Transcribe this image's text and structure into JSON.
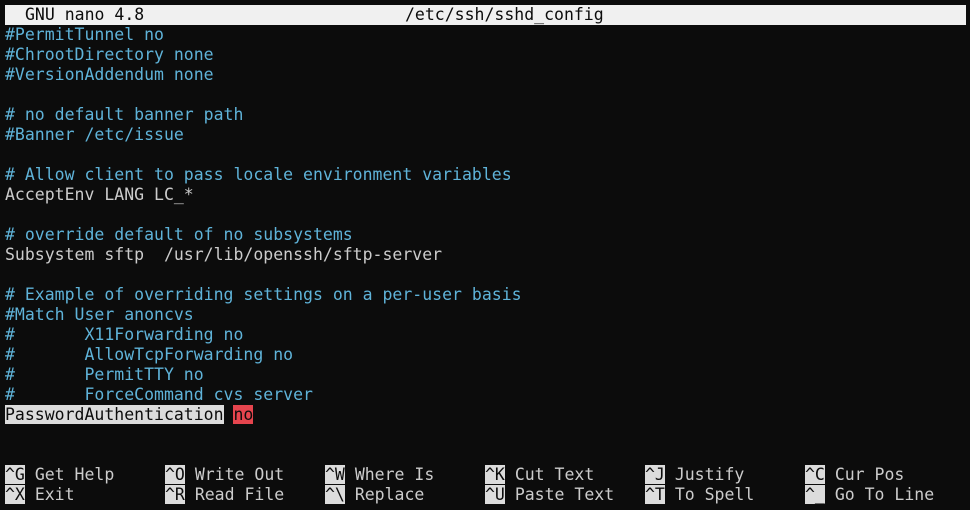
{
  "titlebar": {
    "app": "GNU nano 4.8",
    "file": "/etc/ssh/sshd_config"
  },
  "lines": [
    {
      "text": "#PermitTunnel no",
      "kind": "comment"
    },
    {
      "text": "#ChrootDirectory none",
      "kind": "comment"
    },
    {
      "text": "#VersionAddendum none",
      "kind": "comment"
    },
    {
      "text": "",
      "kind": "plain"
    },
    {
      "text": "# no default banner path",
      "kind": "comment"
    },
    {
      "text": "#Banner /etc/issue",
      "kind": "comment"
    },
    {
      "text": "",
      "kind": "plain"
    },
    {
      "text": "# Allow client to pass locale environment variables",
      "kind": "comment"
    },
    {
      "text": "AcceptEnv LANG LC_*",
      "kind": "plain"
    },
    {
      "text": "",
      "kind": "plain"
    },
    {
      "text": "# override default of no subsystems",
      "kind": "comment"
    },
    {
      "text": "Subsystem sftp  /usr/lib/openssh/sftp-server",
      "kind": "plain"
    },
    {
      "text": "",
      "kind": "plain"
    },
    {
      "text": "# Example of overriding settings on a per-user basis",
      "kind": "comment"
    },
    {
      "text": "#Match User anoncvs",
      "kind": "comment"
    },
    {
      "text": "#       X11Forwarding no",
      "kind": "comment"
    },
    {
      "text": "#       AllowTcpForwarding no",
      "kind": "comment"
    },
    {
      "text": "#       PermitTTY no",
      "kind": "comment"
    },
    {
      "text": "#       ForceCommand cvs server",
      "kind": "comment"
    }
  ],
  "cursor_line": {
    "key": "PasswordAuthentication",
    "value": "no"
  },
  "shortcuts": {
    "row1": [
      {
        "key": "^G",
        "label": "Get Help"
      },
      {
        "key": "^O",
        "label": "Write Out"
      },
      {
        "key": "^W",
        "label": "Where Is"
      },
      {
        "key": "^K",
        "label": "Cut Text"
      },
      {
        "key": "^J",
        "label": "Justify"
      },
      {
        "key": "^C",
        "label": "Cur Pos"
      }
    ],
    "row2": [
      {
        "key": "^X",
        "label": "Exit"
      },
      {
        "key": "^R",
        "label": "Read File"
      },
      {
        "key": "^\\",
        "label": "Replace"
      },
      {
        "key": "^U",
        "label": "Paste Text"
      },
      {
        "key": "^T",
        "label": "To Spell"
      },
      {
        "key": "^_",
        "label": "Go To Line"
      }
    ]
  },
  "colors": {
    "background": "#0c0c0c",
    "comment": "#5fb3d9",
    "text": "#cccccc",
    "titlebar_bg": "#f0f0f0",
    "highlight": "#e6454e"
  }
}
